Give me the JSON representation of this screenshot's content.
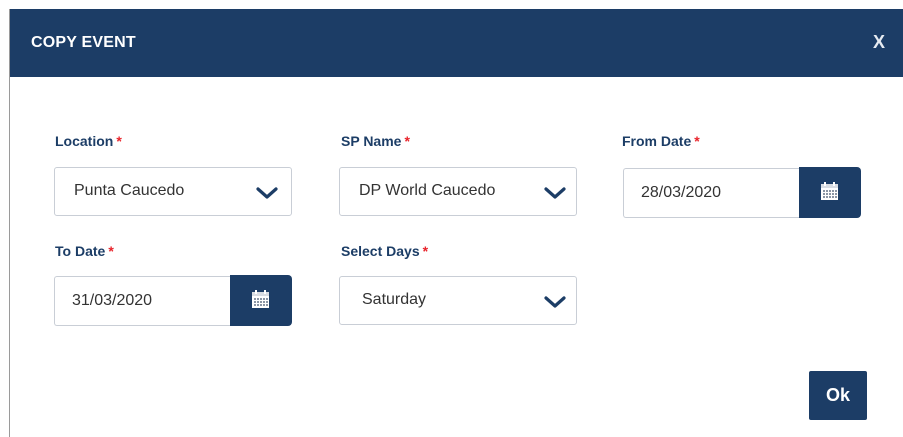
{
  "dialog": {
    "title": "COPY EVENT",
    "close_label": "X",
    "ok_label": "Ok"
  },
  "fields": {
    "location": {
      "label": "Location",
      "required_mark": "*",
      "value": "Punta Caucedo"
    },
    "sp_name": {
      "label": "SP Name",
      "required_mark": "*",
      "value": "DP World Caucedo"
    },
    "from_date": {
      "label": "From Date",
      "required_mark": "*",
      "value": "28/03/2020"
    },
    "to_date": {
      "label": "To Date",
      "required_mark": "*",
      "value": "31/03/2020"
    },
    "select_days": {
      "label": "Select Days",
      "required_mark": "*",
      "value": "Saturday"
    }
  },
  "icons": {
    "chevron": "chevron-down-icon",
    "calendar": "calendar-icon",
    "close": "close-icon"
  },
  "colors": {
    "primary": "#1c3d66",
    "required": "#e8232a",
    "label": "#1c3d66",
    "input_text": "#333333",
    "border": "#c9ced6"
  }
}
